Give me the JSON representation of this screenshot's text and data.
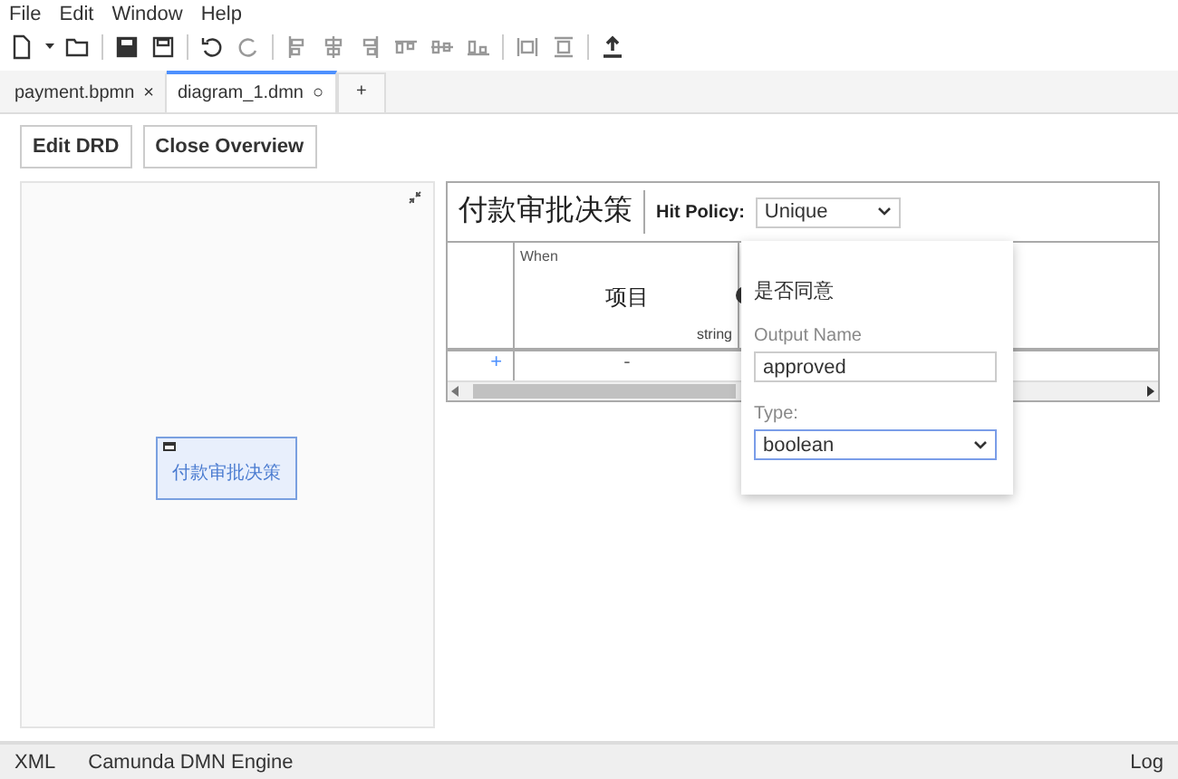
{
  "menu": [
    "File",
    "Edit",
    "Window",
    "Help"
  ],
  "tabs": [
    {
      "label": "payment.bpmn",
      "mark": "×",
      "selected": false
    },
    {
      "label": "diagram_1.dmn",
      "mark": "○",
      "selected": true
    }
  ],
  "new_tab": "+",
  "buttons": [
    "Edit DRD",
    "Close Overview"
  ],
  "drd": {
    "node": "付款审批决策"
  },
  "table": {
    "name": "付款审批决策",
    "hit_policy_label": "Hit Policy:",
    "hit_policy": "Unique",
    "input_group": "When",
    "input_label": "项目",
    "input_type": "string",
    "add_rule": "+",
    "rule_cell": "-"
  },
  "popup": {
    "title": "是否同意",
    "output_name_label": "Output Name",
    "output_name": "approved",
    "type_label": "Type:",
    "type": "boolean"
  },
  "status": {
    "items": [
      "XML",
      "Camunda DMN Engine"
    ],
    "log": "Log"
  }
}
